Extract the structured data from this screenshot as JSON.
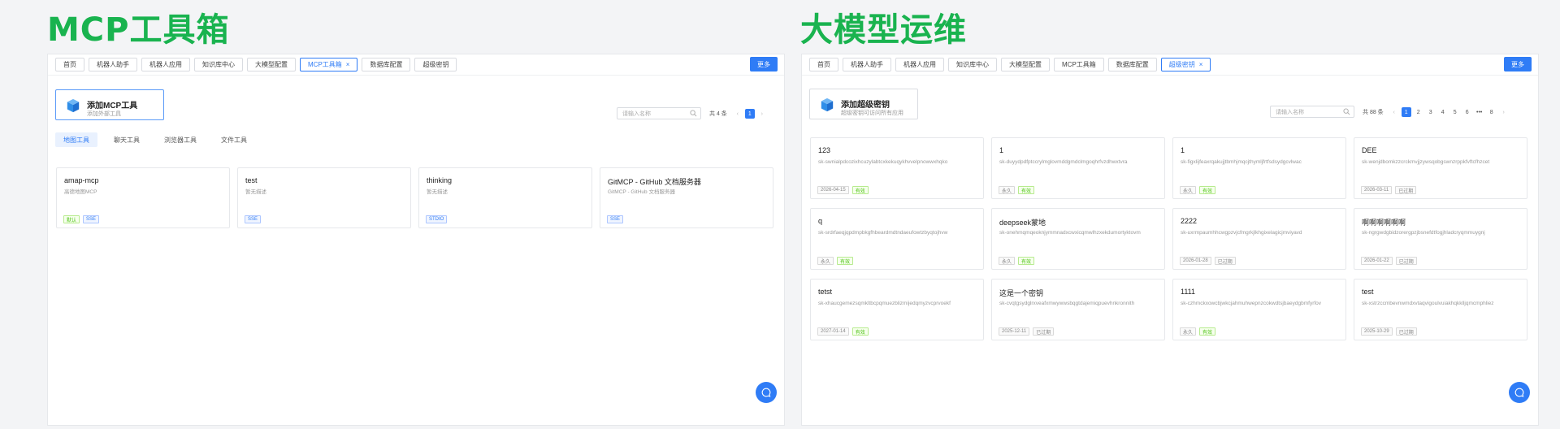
{
  "left": {
    "heading": "MCP工具箱",
    "tabs": [
      {
        "label": "首页",
        "active": false
      },
      {
        "label": "机器人助手",
        "active": false
      },
      {
        "label": "机器人应用",
        "active": false
      },
      {
        "label": "知识库中心",
        "active": false
      },
      {
        "label": "大模型配置",
        "active": false
      },
      {
        "label": "MCP工具箱",
        "active": true
      },
      {
        "label": "数据库配置",
        "active": false
      },
      {
        "label": "超级密钥",
        "active": false
      }
    ],
    "more_label": "更多",
    "add_card": {
      "title": "添加MCP工具",
      "subtitle": "添加外部工具"
    },
    "search": {
      "placeholder": "请输入名称"
    },
    "pager": {
      "total": "共 4 条",
      "current": "1"
    },
    "categories": [
      {
        "label": "地图工具",
        "active": true
      },
      {
        "label": "聊天工具",
        "active": false
      },
      {
        "label": "浏览器工具",
        "active": false
      },
      {
        "label": "文件工具",
        "active": false
      }
    ],
    "cards": [
      {
        "title": "amap-mcp",
        "desc": "高德地图MCP",
        "badges": [
          {
            "text": "默认",
            "style": "green"
          },
          {
            "text": "SSE",
            "style": "blue"
          }
        ]
      },
      {
        "title": "test",
        "desc": "暂无描述",
        "badges": [
          {
            "text": "SSE",
            "style": "blue"
          }
        ]
      },
      {
        "title": "thinking",
        "desc": "暂无描述",
        "badges": [
          {
            "text": "STDIO",
            "style": "blue"
          }
        ]
      },
      {
        "title": "GitMCP - GitHub 文档服务器",
        "desc": "GitMCP - GitHub 文档服务器",
        "badges": [
          {
            "text": "SSE",
            "style": "blue"
          }
        ]
      }
    ]
  },
  "right": {
    "heading": "大模型运维",
    "tabs": [
      {
        "label": "首页",
        "active": false
      },
      {
        "label": "机器人助手",
        "active": false
      },
      {
        "label": "机器人应用",
        "active": false
      },
      {
        "label": "知识库中心",
        "active": false
      },
      {
        "label": "大模型配置",
        "active": false
      },
      {
        "label": "MCP工具箱",
        "active": false
      },
      {
        "label": "数据库配置",
        "active": false
      },
      {
        "label": "超级密钥",
        "active": true
      }
    ],
    "more_label": "更多",
    "add_card": {
      "title": "添加超级密钥",
      "subtitle": "超级密钥可访问所有应用"
    },
    "search": {
      "placeholder": "请输入名称"
    },
    "pager": {
      "total": "共 88 条",
      "pages": [
        "1",
        "2",
        "3",
        "4",
        "5",
        "6",
        "•••",
        "8"
      ],
      "current": "1"
    },
    "cards": [
      {
        "title": "123",
        "desc": "sk-swnialpdcozixhcuzylabtcxkekuqykhvvelpnowwxhqko",
        "badges": [
          {
            "text": "2026-04-15",
            "style": "gray"
          },
          {
            "text": "有效",
            "style": "green"
          }
        ]
      },
      {
        "title": "1",
        "desc": "sk-duyydpdfptccrylmglovmddgmdclmgoqhrfvzdhwxtvra",
        "badges": [
          {
            "text": "永久",
            "style": "gray"
          },
          {
            "text": "有效",
            "style": "green"
          }
        ]
      },
      {
        "title": "1",
        "desc": "sk-figxlijfeaxrqakujjtbmhjmqcjthymljfrtfsdsydgcvlwac",
        "badges": [
          {
            "text": "永久",
            "style": "gray"
          },
          {
            "text": "有效",
            "style": "green"
          }
        ]
      },
      {
        "title": "DEE",
        "desc": "sk-wenjdbomkzzcrckmvjjzywsqobgswnzrppkfvftcfhzcet",
        "badges": [
          {
            "text": "2026-03-11",
            "style": "gray"
          },
          {
            "text": "已过期",
            "style": "gray"
          }
        ]
      },
      {
        "title": "q",
        "desc": "sk-srdrfaeqjqpdmpbkgfhbeardmdtndaeufowtzbyqtojhvw",
        "badges": [
          {
            "text": "永久",
            "style": "gray"
          },
          {
            "text": "有效",
            "style": "green"
          }
        ]
      },
      {
        "title": "deepseek蒙地",
        "desc": "sk-onehmqmqeoknjymmnadxcwxicqmwlhzxekdumortyktovm",
        "badges": [
          {
            "text": "永久",
            "style": "gray"
          },
          {
            "text": "有效",
            "style": "green"
          }
        ]
      },
      {
        "title": "2222",
        "desc": "sk-uxrmpaumhhcwgpzvjcfmgrkjlkhgixelagicjmviyavd",
        "badges": [
          {
            "text": "2026-01-28",
            "style": "gray"
          },
          {
            "text": "已过期",
            "style": "gray"
          }
        ]
      },
      {
        "title": "啊啊啊啊啊啊",
        "desc": "sk-ngrgwdgbidzorergpzjbsnefdtfogjhladcryqmmuygnj",
        "badges": [
          {
            "text": "2026-01-22",
            "style": "gray"
          },
          {
            "text": "已过期",
            "style": "gray"
          }
        ]
      },
      {
        "title": "tetst",
        "desc": "sk-xhaucgemezsqmkltbcpqmuezblizmijedqmyzvcprvoekf",
        "badges": [
          {
            "text": "2027-01-14",
            "style": "gray"
          },
          {
            "text": "有效",
            "style": "green"
          }
        ]
      },
      {
        "title": "这是一个密钥",
        "desc": "sk-cvqtgsydglrxveafxmwywwsbqgtdajemiqpuevhnkronnith",
        "badges": [
          {
            "text": "2025-12-11",
            "style": "gray"
          },
          {
            "text": "已过期",
            "style": "gray"
          }
        ]
      },
      {
        "title": "1111",
        "desc": "sk-czhmckxowcbjwkcjahmuhwepnzcokwdtsjbaeydgbmfyrfov",
        "badges": [
          {
            "text": "永久",
            "style": "gray"
          },
          {
            "text": "有效",
            "style": "green"
          }
        ]
      },
      {
        "title": "test",
        "desc": "sk-xstrzccmbevnwmdxvtaqvigoulvuiakhqkklljqmcmphliez",
        "badges": [
          {
            "text": "2025-10-29",
            "style": "gray"
          },
          {
            "text": "已过期",
            "style": "gray"
          }
        ]
      }
    ]
  }
}
